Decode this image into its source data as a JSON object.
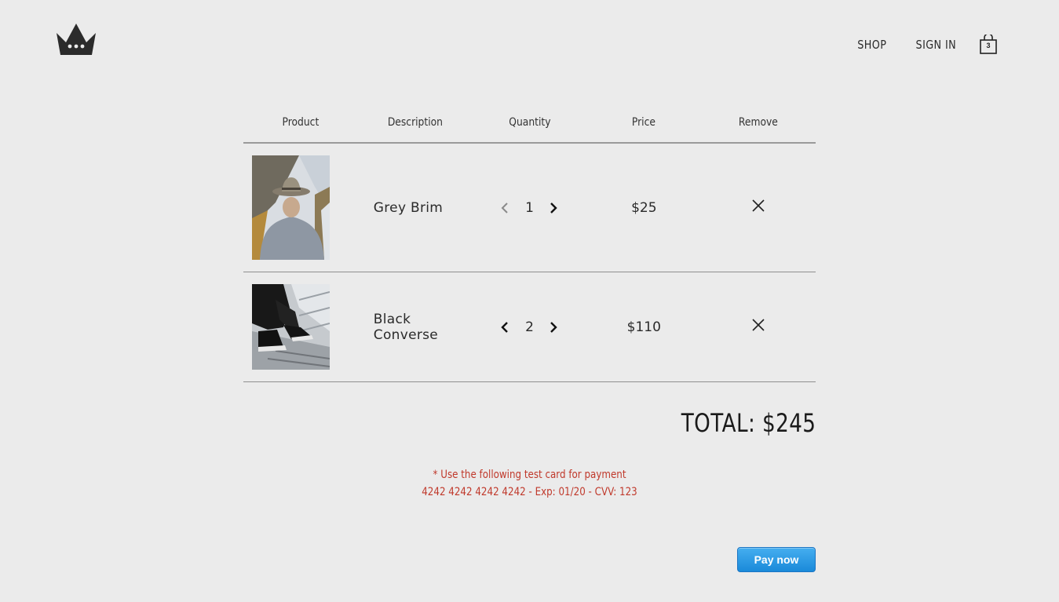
{
  "nav": {
    "logo_icon": "crown-icon",
    "links": [
      "SHOP",
      "SIGN IN"
    ],
    "cart_icon": "shopping-bag-icon",
    "cart_count": "3"
  },
  "table": {
    "headers": [
      "Product",
      "Description",
      "Quantity",
      "Price",
      "Remove"
    ],
    "rows": [
      {
        "image": "man-in-grey-hat-photo",
        "description": "Grey Brim",
        "quantity": "1",
        "price": "$25",
        "decrement_icon": "chevron-left-icon",
        "increment_icon": "chevron-right-icon",
        "remove_icon": "close-icon"
      },
      {
        "image": "black-converse-shoes-photo",
        "description": "Black Converse",
        "quantity": "2",
        "price": "$110",
        "decrement_icon": "chevron-left-icon",
        "increment_icon": "chevron-right-icon",
        "remove_icon": "close-icon"
      }
    ]
  },
  "total": "TOTAL: $245",
  "note": {
    "line1": "* Use the following test card for payment",
    "line2": "4242 4242 4242 4242 - Exp: 01/20 - CVV: 123"
  },
  "pay_button": "Pay now",
  "colors": {
    "background": "#ebebeb",
    "note_text": "#c0392b",
    "pay_button": "#2196e3"
  }
}
